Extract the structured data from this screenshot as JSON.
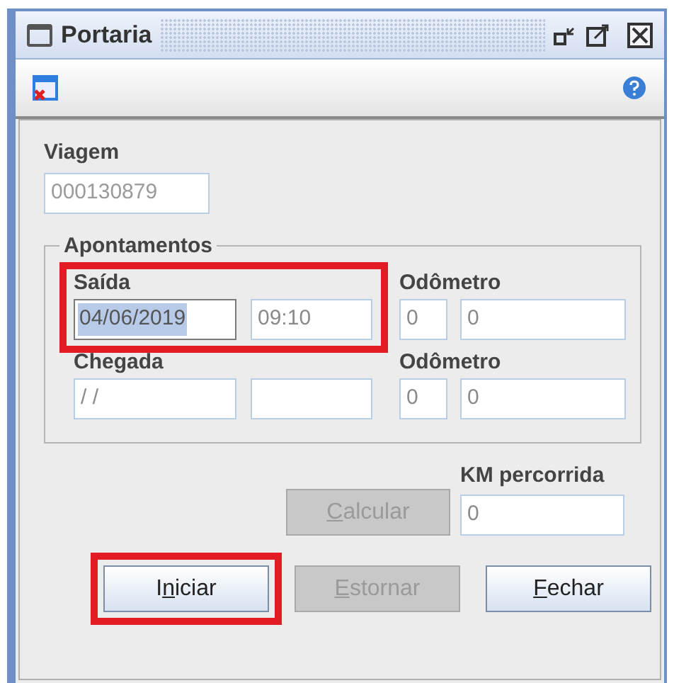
{
  "window": {
    "title": "Portaria"
  },
  "viagem": {
    "label": "Viagem",
    "value": "000130879",
    "disabled": true
  },
  "apontamentos": {
    "title": "Apontamentos",
    "rows": [
      {
        "label": "Saída",
        "highlighted": true,
        "date": {
          "value": "04/06/2019",
          "text_selected": true
        },
        "time": {
          "value": "09:10"
        },
        "odometer_label": "Odômetro",
        "odometer_prefix": "0",
        "odometer": "0"
      },
      {
        "label": "Chegada",
        "highlighted": false,
        "date": {
          "value": "/ /",
          "text_selected": false
        },
        "time": {},
        "odometer_label": "Odômetro",
        "odometer_prefix": "0",
        "odometer": "0"
      }
    ]
  },
  "km": {
    "label": "KM percorrida",
    "value": "0"
  },
  "calculate_button": {
    "mnemonic": "C",
    "after": "alcular",
    "disabled": true
  },
  "buttons": [
    {
      "before": "I",
      "mnemonic": "n",
      "after": "iciar",
      "disabled": false,
      "highlighted": true
    },
    {
      "mnemonic": "E",
      "after": "stornar",
      "disabled": true,
      "highlighted": false
    },
    {
      "mnemonic": "F",
      "after": "echar",
      "disabled": false,
      "highlighted": false
    }
  ]
}
